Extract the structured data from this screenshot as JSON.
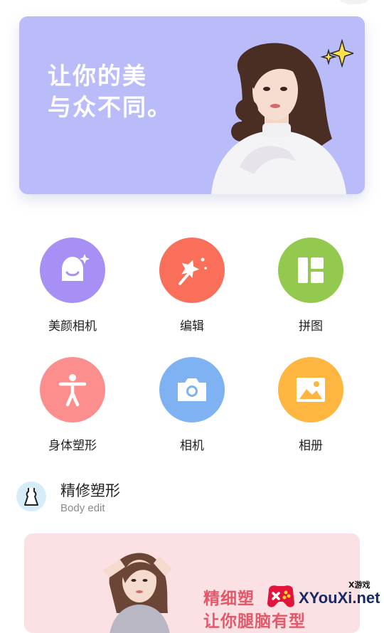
{
  "hero": {
    "line1": "让你的美",
    "line2": "与众不同。"
  },
  "tools": [
    {
      "label": "美颜相机",
      "icon": "beauty-camera-icon",
      "color": "#a88ff5"
    },
    {
      "label": "编辑",
      "icon": "magic-wand-icon",
      "color": "#fa6f5a"
    },
    {
      "label": "拼图",
      "icon": "collage-icon",
      "color": "#94c94f"
    },
    {
      "label": "身体塑形",
      "icon": "body-icon",
      "color": "#fd8e8e"
    },
    {
      "label": "相机",
      "icon": "camera-icon",
      "color": "#7fb2f3"
    },
    {
      "label": "相册",
      "icon": "album-icon",
      "color": "#ffb640"
    }
  ],
  "section": {
    "title": "精修塑形",
    "subtitle": "Body edit",
    "icon": "dress-icon"
  },
  "banner2": {
    "line1": "精细塑",
    "line2": "让你腿脑有型"
  },
  "watermark": {
    "small": "X游戏",
    "site": "XYouXi.net"
  }
}
